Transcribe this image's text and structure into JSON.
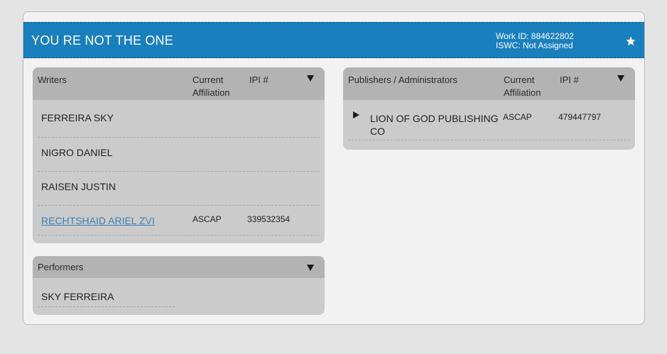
{
  "work": {
    "title": "YOU RE NOT THE ONE",
    "work_id": "Work ID: 884622802",
    "iswc": "ISWC:  Not Assigned",
    "favorite_icon": "star-icon"
  },
  "writers": {
    "header": {
      "col1": "Writers",
      "col2_line1": "Current",
      "col2_line2": "Affiliation",
      "col3": "IPI #"
    },
    "rows": [
      {
        "name": "FERREIRA SKY",
        "affiliation": "",
        "ipi": ""
      },
      {
        "name": "NIGRO DANIEL",
        "affiliation": "",
        "ipi": ""
      },
      {
        "name": "RAISEN JUSTIN",
        "affiliation": "",
        "ipi": ""
      },
      {
        "name": "RECHTSHAID ARIEL ZVI",
        "affiliation": "ASCAP",
        "ipi": "339532354"
      }
    ]
  },
  "performers": {
    "header": {
      "col1": "Performers"
    },
    "rows": [
      {
        "name": "SKY FERREIRA"
      }
    ]
  },
  "publishers": {
    "header": {
      "col1": "Publishers / Administrators",
      "col2_line1": "Current",
      "col2_line2": "Affiliation",
      "col3": "IPI #"
    },
    "rows": [
      {
        "name_line1": "LION OF GOD PUBLISHING",
        "name_line2": "CO",
        "affiliation": "ASCAP",
        "ipi": "479447797"
      }
    ]
  }
}
